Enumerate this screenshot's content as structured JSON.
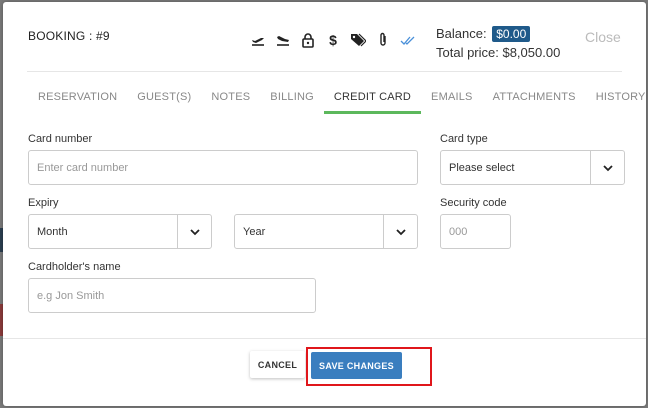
{
  "header": {
    "booking_title": "BOOKING : #9",
    "balance_label": "Balance:",
    "balance_value": "$0.00",
    "total_price": "Total price: $8,050.00",
    "close_label": "Close",
    "icons": [
      "plane-departure-icon",
      "plane-arrival-icon",
      "lock-icon",
      "dollar-icon",
      "tags-icon",
      "paperclip-icon",
      "double-check-icon"
    ]
  },
  "tabs": [
    {
      "label": "RESERVATION",
      "active": false
    },
    {
      "label": "GUEST(S)",
      "active": false
    },
    {
      "label": "NOTES",
      "active": false
    },
    {
      "label": "BILLING",
      "active": false
    },
    {
      "label": "CREDIT CARD",
      "active": true
    },
    {
      "label": "EMAILS",
      "active": false
    },
    {
      "label": "ATTACHMENTS",
      "active": false
    },
    {
      "label": "HISTORY",
      "active": false
    }
  ],
  "form": {
    "card_number_label": "Card number",
    "card_number_placeholder": "Enter card number",
    "card_type_label": "Card type",
    "card_type_value": "Please select",
    "expiry_label": "Expiry",
    "month_value": "Month",
    "year_value": "Year",
    "security_code_label": "Security code",
    "security_code_placeholder": "000",
    "cardholder_label": "Cardholder's name",
    "cardholder_placeholder": "e.g Jon Smith"
  },
  "footer": {
    "cancel_label": "CANCEL",
    "save_label": "SAVE CHANGES"
  },
  "colors": {
    "accent_green": "#5cb85c",
    "primary_blue": "#3a7ebf",
    "badge_blue": "#1f5a8a",
    "highlight_red": "#e0161b"
  }
}
